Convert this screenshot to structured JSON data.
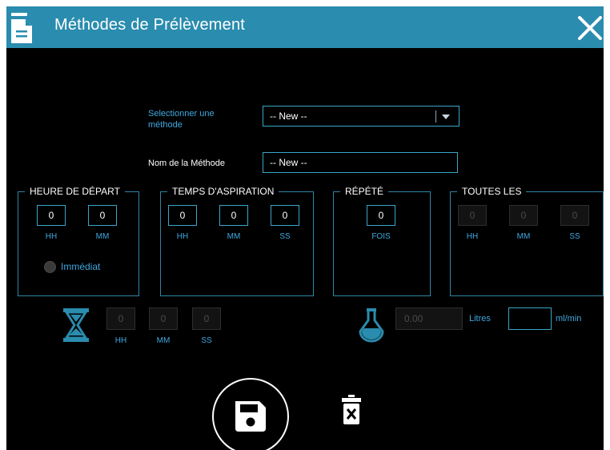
{
  "window": {
    "title": "Méthodes de Prélèvement"
  },
  "form": {
    "method_label": "Selectionner une méthode",
    "method_value": "-- New --",
    "name_label": "Nom de la Méthode",
    "name_value": "-- New --"
  },
  "groups": {
    "start": {
      "legend": "HEURE DE DÉPART",
      "hh": "0",
      "mm": "0",
      "unit_hh": "HH",
      "unit_mm": "MM",
      "immediate_label": "Immédiat"
    },
    "aspiration": {
      "legend": "TEMPS D'ASPIRATION",
      "hh": "0",
      "mm": "0",
      "ss": "0",
      "unit_hh": "HH",
      "unit_mm": "MM",
      "unit_ss": "SS"
    },
    "repeat": {
      "legend": "RÉPÉTÉ",
      "count": "0",
      "unit": "FOIS"
    },
    "every": {
      "legend": "TOUTES LES",
      "hh": "0",
      "mm": "0",
      "ss": "0",
      "unit_hh": "HH",
      "unit_mm": "MM",
      "unit_ss": "SS"
    }
  },
  "summary": {
    "duration": {
      "hh": "0",
      "mm": "0",
      "ss": "0",
      "unit_hh": "HH",
      "unit_mm": "MM",
      "unit_ss": "SS"
    },
    "volume_value": "0.00",
    "volume_unit": "Litres",
    "flow_value": "",
    "flow_unit": "ml/min"
  },
  "icons": {
    "document": "document-icon",
    "close": "close-icon",
    "hourglass": "hourglass-icon",
    "flask": "flask-icon",
    "save": "save-icon",
    "delete": "trash-icon"
  },
  "colors": {
    "titlebar": "#2a8cae",
    "accent": "#3aa6c8",
    "background": "#000000"
  }
}
